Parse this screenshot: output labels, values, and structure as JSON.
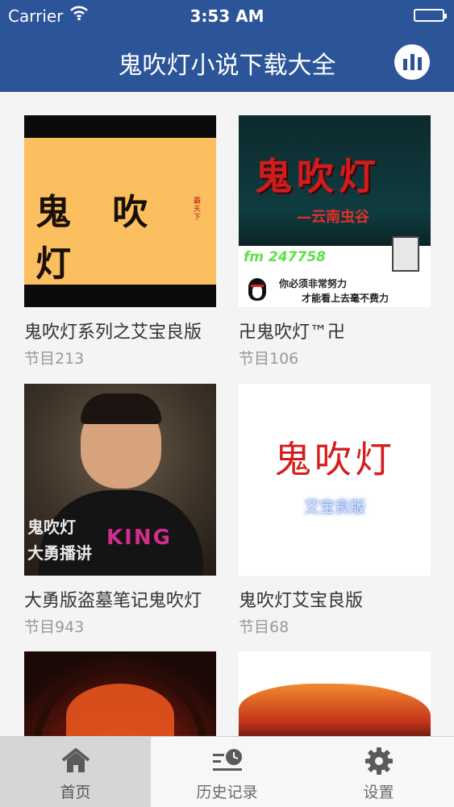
{
  "status_bar": {
    "carrier": "Carrier",
    "time": "3:53 AM"
  },
  "nav": {
    "title": "鬼吹灯小说下载大全",
    "right_button_icon": "equalizer-icon"
  },
  "cards": [
    {
      "name": "鬼吹灯系列之艾宝良版",
      "count": "节目213",
      "art": {
        "title": "鬼 吹 灯",
        "seal": "霸天下"
      }
    },
    {
      "name": "卍鬼吹灯™卍",
      "count": "节目106",
      "art": {
        "title": "鬼吹灯",
        "subtitle": "—云南虫谷",
        "fm": "fm 247758",
        "note_line1": "你必须非常努力",
        "note_line2": "才能看上去毫不费力"
      }
    },
    {
      "name": "大勇版盗墓笔记鬼吹灯",
      "count": "节目943",
      "art": {
        "shirt_text": "KING",
        "caption_line1": "鬼吹灯",
        "caption_line2": "大勇播讲"
      }
    },
    {
      "name": "鬼吹灯艾宝良版",
      "count": "节目68",
      "art": {
        "title": "鬼吹灯",
        "subtitle": "艾宝良版"
      }
    }
  ],
  "tabs": [
    {
      "label": "首页",
      "icon": "home-icon",
      "active": true
    },
    {
      "label": "历史记录",
      "icon": "history-icon",
      "active": false
    },
    {
      "label": "设置",
      "icon": "gear-icon",
      "active": false
    }
  ],
  "colors": {
    "brand": "#2c5499",
    "text": "#333333",
    "muted": "#999999"
  }
}
